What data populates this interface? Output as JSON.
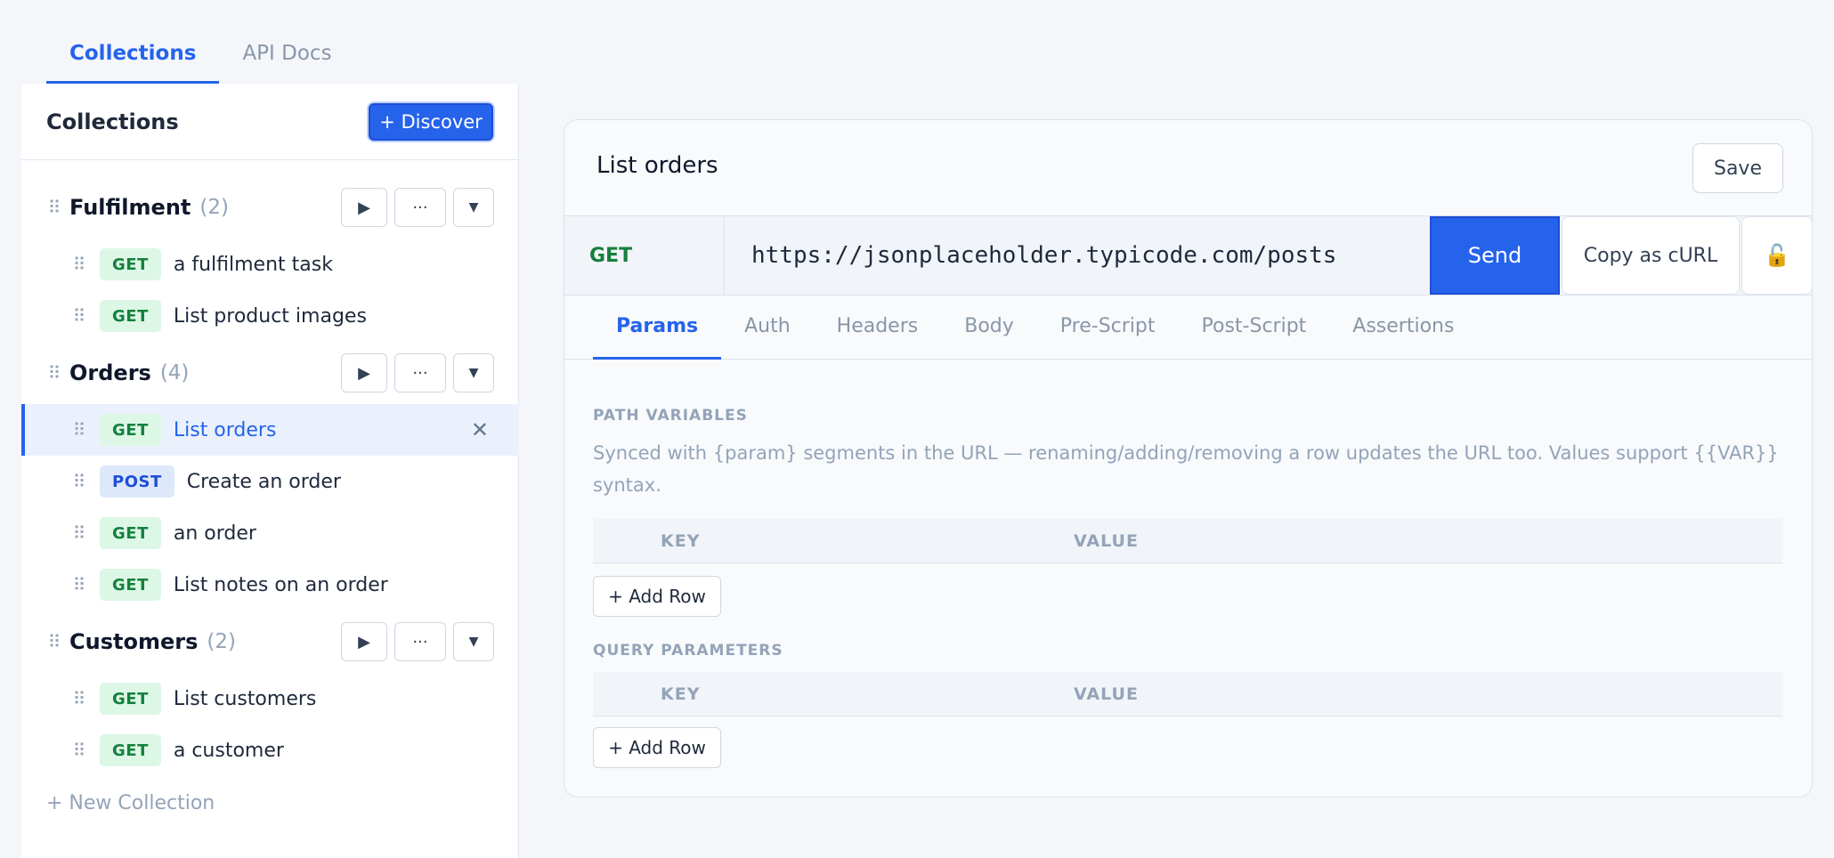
{
  "top_tabs": [
    {
      "label": "Collections",
      "active": true
    },
    {
      "label": "API Docs",
      "active": false
    }
  ],
  "sidebar": {
    "title": "Collections",
    "discover_label": "+ Discover",
    "groups": [
      {
        "name": "Fulfilment",
        "count": "(2)",
        "requests": [
          {
            "method": "GET",
            "name": "a fulfilment task"
          },
          {
            "method": "GET",
            "name": "List product images"
          }
        ]
      },
      {
        "name": "Orders",
        "count": "(4)",
        "requests": [
          {
            "method": "GET",
            "name": "List orders",
            "active": true
          },
          {
            "method": "POST",
            "name": "Create an order"
          },
          {
            "method": "GET",
            "name": "an order"
          },
          {
            "method": "GET",
            "name": "List notes on an order"
          }
        ]
      },
      {
        "name": "Customers",
        "count": "(2)",
        "requests": [
          {
            "method": "GET",
            "name": "List customers"
          },
          {
            "method": "GET",
            "name": "a customer"
          }
        ]
      }
    ],
    "group_buttons": {
      "run": "▶",
      "more": "···",
      "expand": "▼"
    },
    "close_icon": "✕",
    "new_collection": "+ New Collection"
  },
  "request": {
    "title": "List orders",
    "save_label": "Save",
    "method": "GET",
    "url": "https://jsonplaceholder.typicode.com/posts",
    "send_label": "Send",
    "curl_label": "Copy as cURL",
    "lock_icon": "🔓",
    "tabs": [
      {
        "label": "Params",
        "active": true
      },
      {
        "label": "Auth"
      },
      {
        "label": "Headers"
      },
      {
        "label": "Body"
      },
      {
        "label": "Pre-Script"
      },
      {
        "label": "Post-Script"
      },
      {
        "label": "Assertions"
      }
    ],
    "path_variables": {
      "label": "PATH VARIABLES",
      "help": "Synced with {param} segments in the URL — renaming/adding/removing a row updates the URL too. Values support {{VAR}} syntax.",
      "key_header": "KEY",
      "value_header": "VALUE",
      "add_row": "+ Add Row"
    },
    "query_parameters": {
      "label": "QUERY PARAMETERS",
      "key_header": "KEY",
      "value_header": "VALUE",
      "add_row": "+ Add Row"
    }
  },
  "colors": {
    "accent": "#2563eb",
    "get": "#15803d",
    "post": "#1d4ed8"
  }
}
